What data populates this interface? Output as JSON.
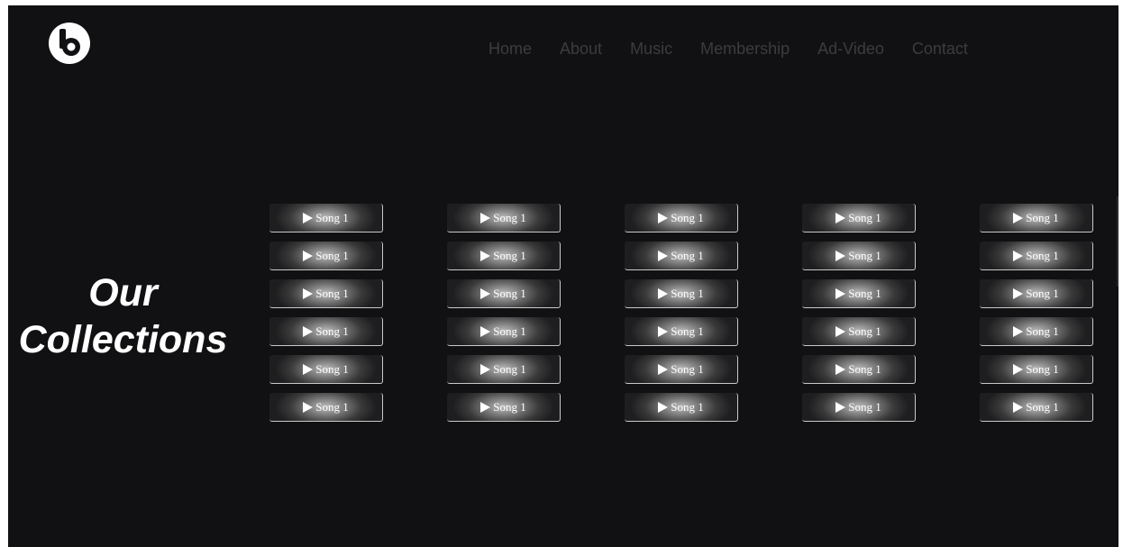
{
  "nav": {
    "items": [
      "Home",
      "About",
      "Music",
      "Membership",
      "Ad-Video",
      "Contact"
    ]
  },
  "logo": {
    "icon": "beats-b-logo-icon"
  },
  "heading": {
    "line1": "Our",
    "line2": "Collections"
  },
  "songs": {
    "columns": [
      [
        "Song 1",
        "Song 1",
        "Song 1",
        "Song 1",
        "Song 1",
        "Song 1"
      ],
      [
        "Song 1",
        "Song 1",
        "Song 1",
        "Song 1",
        "Song 1",
        "Song 1"
      ],
      [
        "Song 1",
        "Song 1",
        "Song 1",
        "Song 1",
        "Song 1",
        "Song 1"
      ],
      [
        "Song 1",
        "Song 1",
        "Song 1",
        "Song 1",
        "Song 1",
        "Song 1"
      ],
      [
        "Song 1",
        "Song 1",
        "Song 1",
        "Song 1",
        "Song 1",
        "Song 1"
      ]
    ],
    "play_icon": "play-icon"
  },
  "colors": {
    "background": "#111113",
    "nav_text": "#3c3c3e",
    "heading_text": "#ffffff"
  }
}
